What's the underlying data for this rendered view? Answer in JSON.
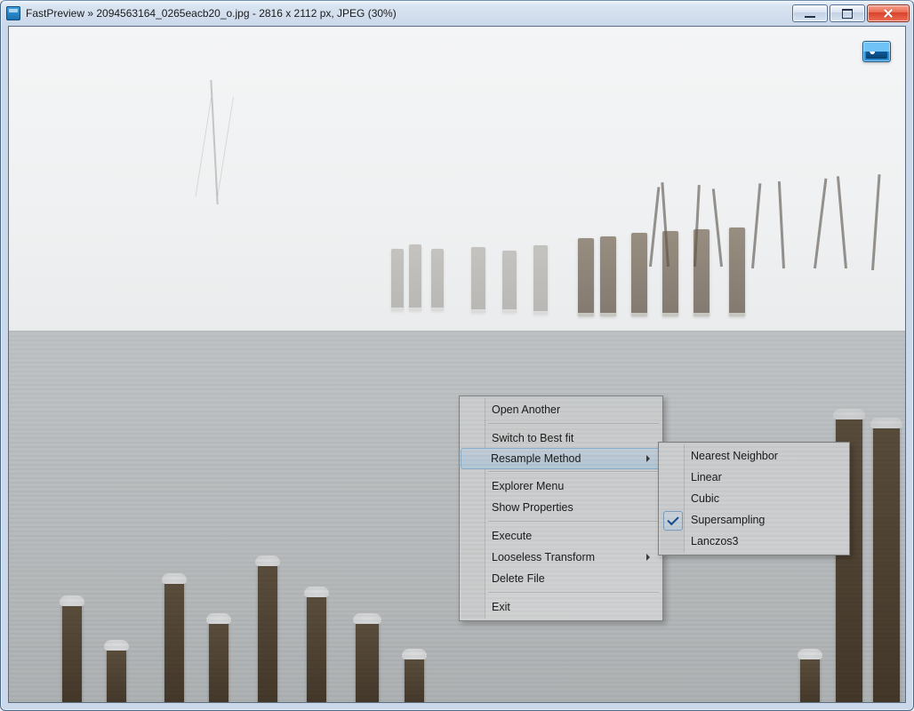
{
  "title": "FastPreview » 2094563164_0265eacb20_o.jpg - 2816 x 2112 px, JPEG (30%)",
  "overlay_icon": "thumbnail-icon",
  "menu": {
    "open": "Open Another",
    "bestfit": "Switch to Best fit",
    "resample": "Resample Method",
    "explorer": "Explorer Menu",
    "props": "Show Properties",
    "execute": "Execute",
    "lossless": "Looseless Transform",
    "delete": "Delete File",
    "exit": "Exit"
  },
  "resample": {
    "nearest": "Nearest Neighbor",
    "linear": "Linear",
    "cubic": "Cubic",
    "super": "Supersampling",
    "lanczos": "Lanczos3",
    "checked": "super"
  }
}
